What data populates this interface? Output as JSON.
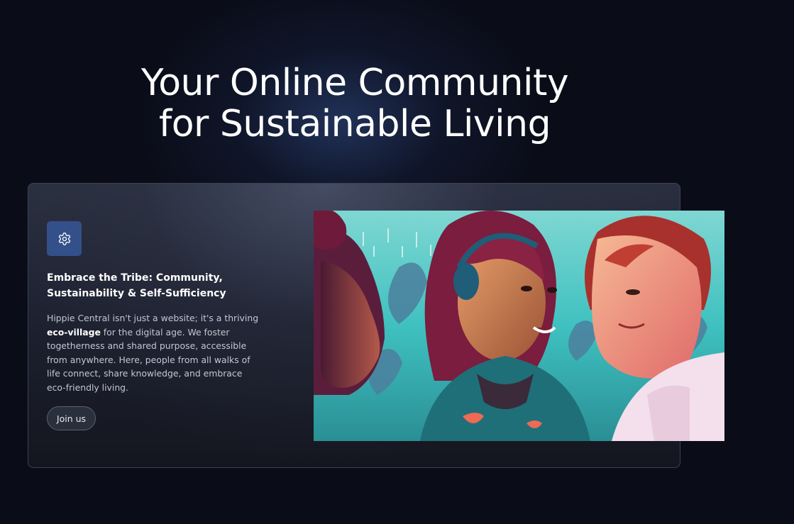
{
  "hero": {
    "title_line1": "Your Online Community",
    "title_line2": "for Sustainable Living"
  },
  "card": {
    "icon": "gear-icon",
    "heading": "Embrace the Tribe: Community, Sustainability & Self-Sufficiency",
    "body_before": "Hippie Central isn't just a website; it's a thriving ",
    "body_bold": "eco-village",
    "body_after": " for the digital age. We foster togetherness and shared purpose, accessible from anywhere. Here, people from all walks of life connect, share knowledge, and embrace eco-friendly living.",
    "join_label": "Join us"
  },
  "colors": {
    "background": "#0a0c17",
    "icon_tile": "#34508a",
    "card_border": "#3c4356"
  }
}
